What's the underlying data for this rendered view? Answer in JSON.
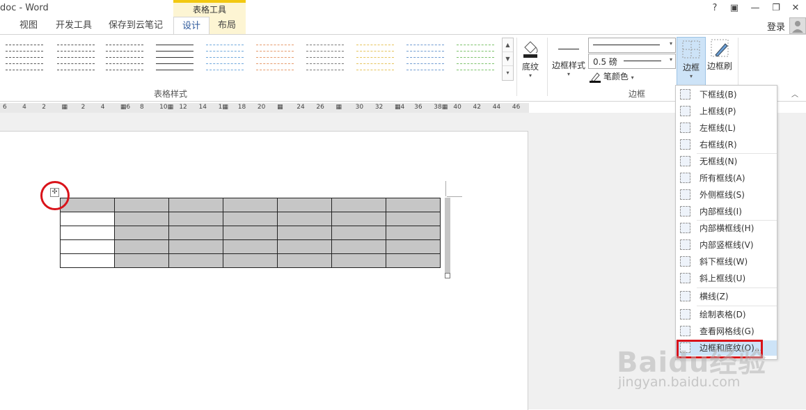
{
  "window": {
    "title": "doc - Word",
    "context_group": "表格工具",
    "buttons": {
      "help": "?",
      "ribbon_options": "▣",
      "restore": "❐",
      "close": "✕"
    }
  },
  "tabs": [
    {
      "label": "视图"
    },
    {
      "label": "开发工具"
    },
    {
      "label": "保存到云笔记"
    },
    {
      "label": "设计"
    },
    {
      "label": "布局"
    }
  ],
  "account": {
    "login": "登录"
  },
  "ribbon": {
    "group_table_styles": "表格样式",
    "group_borders": "边框",
    "shading": "底纹",
    "border_styles": "边框样式",
    "line_weight": "0.5 磅",
    "pen_color": "笔颜色",
    "borders": "边框",
    "border_painter": "边框刷",
    "style_colors": [
      "#555555",
      "#555555",
      "#555555",
      "#333333",
      "#6fa8dc",
      "#e69a6b",
      "#777777",
      "#e6c45c",
      "#6f9bd1",
      "#7cc26a"
    ]
  },
  "ruler": {
    "ticks": [
      "6",
      "4",
      "2",
      "▦",
      "2",
      "4",
      "▦6",
      "8",
      "10▦",
      "12",
      "14",
      "1▦",
      "18",
      "20",
      "▦",
      "24",
      "26",
      "▦",
      "30",
      "32",
      "▦4",
      "36",
      "38▦",
      "40",
      "42",
      "44",
      "46"
    ]
  },
  "borders_menu": {
    "items": [
      {
        "label": "下框线(B)",
        "icon": "bottom-border-icon"
      },
      {
        "label": "上框线(P)",
        "icon": "top-border-icon"
      },
      {
        "label": "左框线(L)",
        "icon": "left-border-icon"
      },
      {
        "label": "右框线(R)",
        "icon": "right-border-icon"
      },
      {
        "label": "无框线(N)",
        "icon": "no-border-icon"
      },
      {
        "label": "所有框线(A)",
        "icon": "all-borders-icon"
      },
      {
        "label": "外侧框线(S)",
        "icon": "outside-borders-icon"
      },
      {
        "label": "内部框线(I)",
        "icon": "inside-borders-icon"
      },
      {
        "label": "内部横框线(H)",
        "icon": "inside-horizontal-border-icon"
      },
      {
        "label": "内部竖框线(V)",
        "icon": "inside-vertical-border-icon"
      },
      {
        "label": "斜下框线(W)",
        "icon": "diagonal-down-border-icon"
      },
      {
        "label": "斜上框线(U)",
        "icon": "diagonal-up-border-icon"
      },
      {
        "label": "横线(Z)",
        "icon": "horizontal-line-icon"
      },
      {
        "label": "绘制表格(D)",
        "icon": "draw-table-icon"
      },
      {
        "label": "查看网格线(G)",
        "icon": "view-gridlines-icon"
      },
      {
        "label": "边框和底纹(O)...",
        "icon": "borders-shading-icon"
      }
    ]
  },
  "watermark": {
    "brand": "Baidu经验",
    "url": "jingyan.baidu.com"
  }
}
